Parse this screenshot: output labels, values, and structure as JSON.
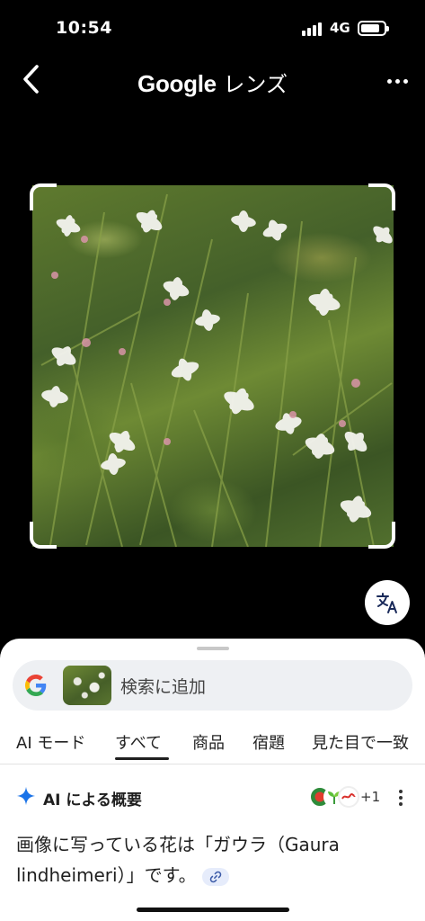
{
  "status_bar": {
    "time": "10:54",
    "network": "4G"
  },
  "header": {
    "brand": "Google",
    "title_suffix": " レンズ",
    "back_icon": "chevron-left-icon",
    "more_icon": "more-horizontal-icon"
  },
  "viewer": {
    "translate_icon": "translate-icon"
  },
  "search_bar": {
    "placeholder": "検索に追加"
  },
  "tabs": [
    {
      "label": "AI モード"
    },
    {
      "label": "すべて",
      "active": true
    },
    {
      "label": "商品"
    },
    {
      "label": "宿題"
    },
    {
      "label": "見た目で一致"
    }
  ],
  "ai_overview": {
    "title": "AI による概要",
    "sources_more": "+1",
    "answer": "画像に写っている花は「ガウラ（Gaura lindheimeri）」です。"
  },
  "colors": {
    "accent_blue": "#1a73e8",
    "sheet_background": "#ffffff",
    "background": "#000000"
  }
}
